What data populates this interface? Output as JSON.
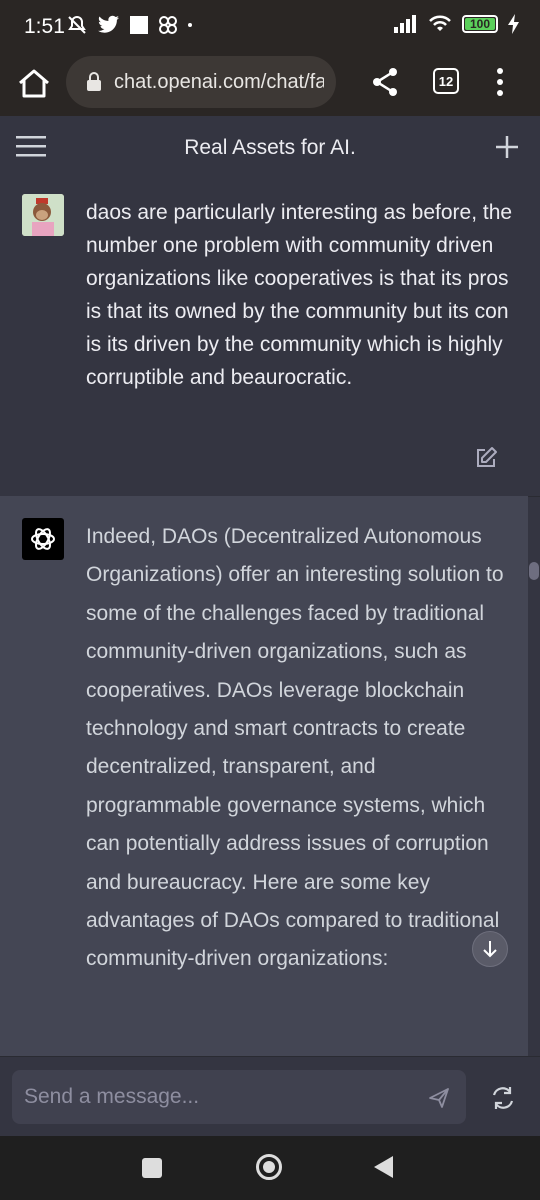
{
  "status_bar": {
    "time": "1:51",
    "battery": "100"
  },
  "browser": {
    "url": "chat.openai.com/chat/fa",
    "tab_count": "12"
  },
  "chat": {
    "title": "Real Assets for AI.",
    "user_message": "daos are particularly interesting as before, the number one problem with community driven organizations like cooperatives is that its pros is that its owned by the community but its con is its driven by the community which is highly corruptible and beaurocratic.",
    "assistant_message": "Indeed, DAOs (Decentralized Autonomous Organizations) offer an interesting solution to some of the challenges faced by traditional community-driven organizations, such as cooperatives. DAOs leverage blockchain technology and smart contracts to create decentralized, transparent, and programmable governance systems, which can potentially address issues of corruption and bureaucracy. Here are some key advantages of DAOs compared to traditional community-driven organizations:"
  },
  "input": {
    "placeholder": "Send a message..."
  },
  "icons": {
    "home": "home-icon",
    "lock": "lock-icon",
    "share": "share-icon",
    "menu": "more-vert-icon",
    "hamburger": "hamburger-icon",
    "new_chat": "plus-icon",
    "edit": "edit-icon",
    "send": "send-icon",
    "regenerate": "regenerate-icon",
    "scroll_down": "arrow-down-icon"
  },
  "colors": {
    "background": "#343541",
    "assistant_background": "#444654",
    "browser_chrome": "#2a2624"
  }
}
